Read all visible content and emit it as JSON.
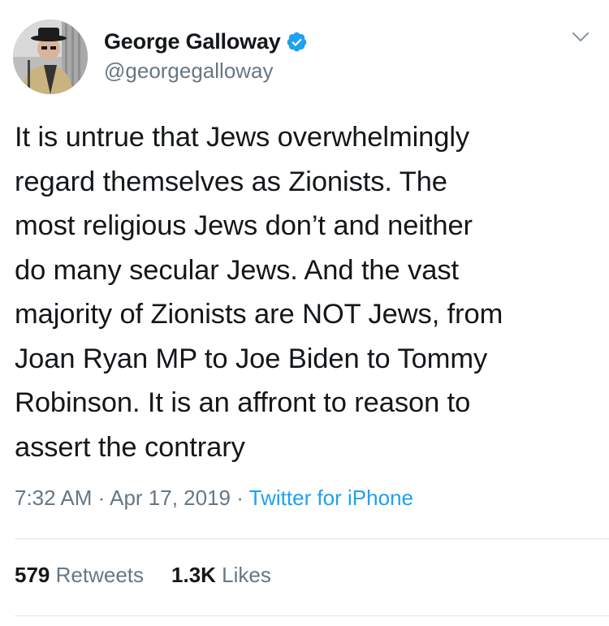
{
  "author": {
    "display_name": "George Galloway",
    "handle": "@georgegalloway",
    "verified": true
  },
  "tweet": {
    "text_lines": [
      "It is untrue that Jews overwhelmingly",
      "regard themselves as Zionists. The",
      "most religious Jews don’t and neither",
      "do many secular Jews. And the vast",
      "majority of Zionists are NOT Jews, from",
      "Joan Ryan MP to Joe Biden to Tommy",
      "Robinson. It is an affront to reason to",
      "assert the contrary"
    ],
    "time": "7:32 AM",
    "separator": "·",
    "date": "Apr 17, 2019",
    "source": "Twitter for iPhone"
  },
  "stats": {
    "retweets_count": "579",
    "retweets_label": "Retweets",
    "likes_count": "1.3K",
    "likes_label": "Likes"
  },
  "icons": {
    "verified": "verified-badge-icon",
    "more": "chevron-down-icon"
  },
  "colors": {
    "primary_text": "#14171a",
    "secondary_text": "#657786",
    "link_blue": "#1da1f2",
    "divider": "#e1e8ed"
  }
}
